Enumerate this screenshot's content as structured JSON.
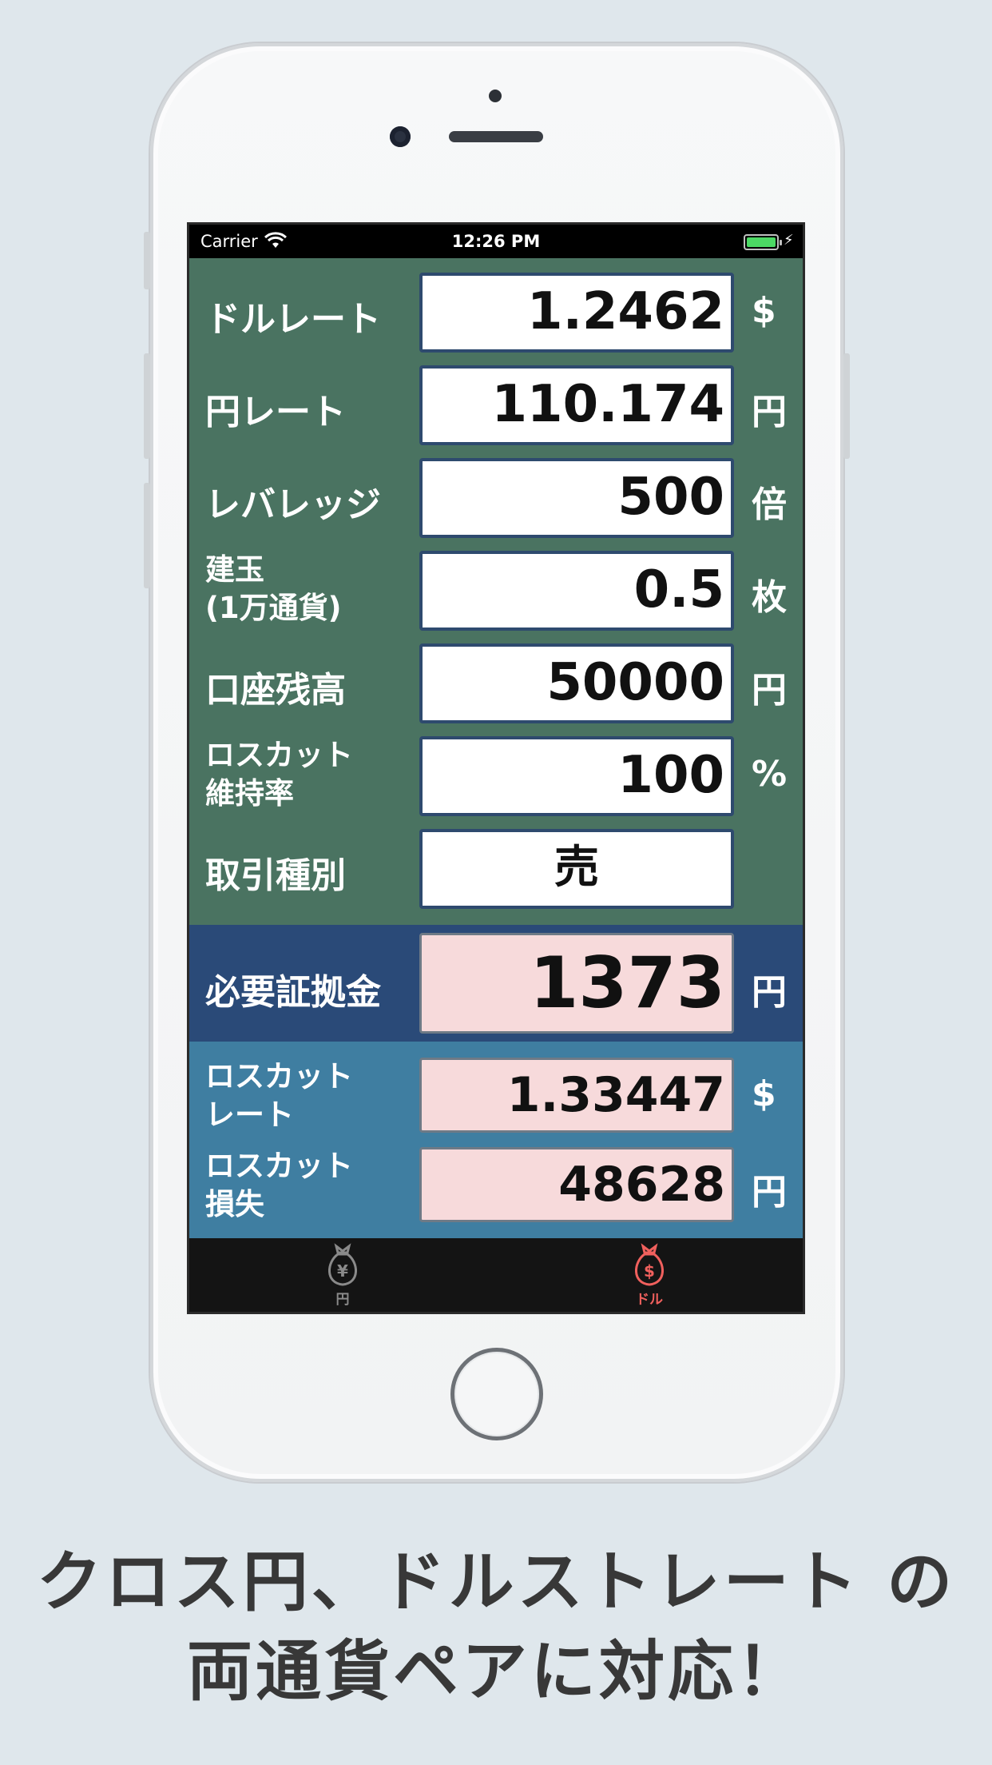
{
  "status": {
    "carrier": "Carrier",
    "time": "12:26 PM"
  },
  "inputs": [
    {
      "label": "ドルレート",
      "value": "1.2462",
      "unit": "$"
    },
    {
      "label": "円レート",
      "value": "110.174",
      "unit": "円"
    },
    {
      "label": "レバレッジ",
      "value": "500",
      "unit": "倍"
    },
    {
      "label_line1": "建玉",
      "label_line2": "(1万通貨)",
      "value": "0.5",
      "unit": "枚"
    },
    {
      "label": "口座残高",
      "value": "50000",
      "unit": "円"
    },
    {
      "label_line1": "ロスカット",
      "label_line2": "維持率",
      "value": "100",
      "unit": "%"
    },
    {
      "label": "取引種別",
      "value": "売"
    }
  ],
  "margin": {
    "label": "必要証拠金",
    "value": "1373",
    "unit": "円"
  },
  "results": [
    {
      "label_line1": "ロスカット",
      "label_line2": "レート",
      "value": "1.33447",
      "unit": "$"
    },
    {
      "label_line1": "ロスカット",
      "label_line2": "損失",
      "value": "48628",
      "unit": "円"
    }
  ],
  "tabs": [
    {
      "label": "円",
      "icon": "yen-moneybag-icon",
      "color": "#8a8a8a"
    },
    {
      "label": "ドル",
      "icon": "dollar-moneybag-icon",
      "color": "#f0605d"
    }
  ],
  "caption": {
    "line1": "クロス円、ドルストレート の",
    "line2": "両通貨ペアに対応！"
  },
  "colors": {
    "input_bg": "#4a7361",
    "main_bg": "#2a4a78",
    "result_bg": "#3f7ea1",
    "page_bg": "#dfe7ec"
  }
}
